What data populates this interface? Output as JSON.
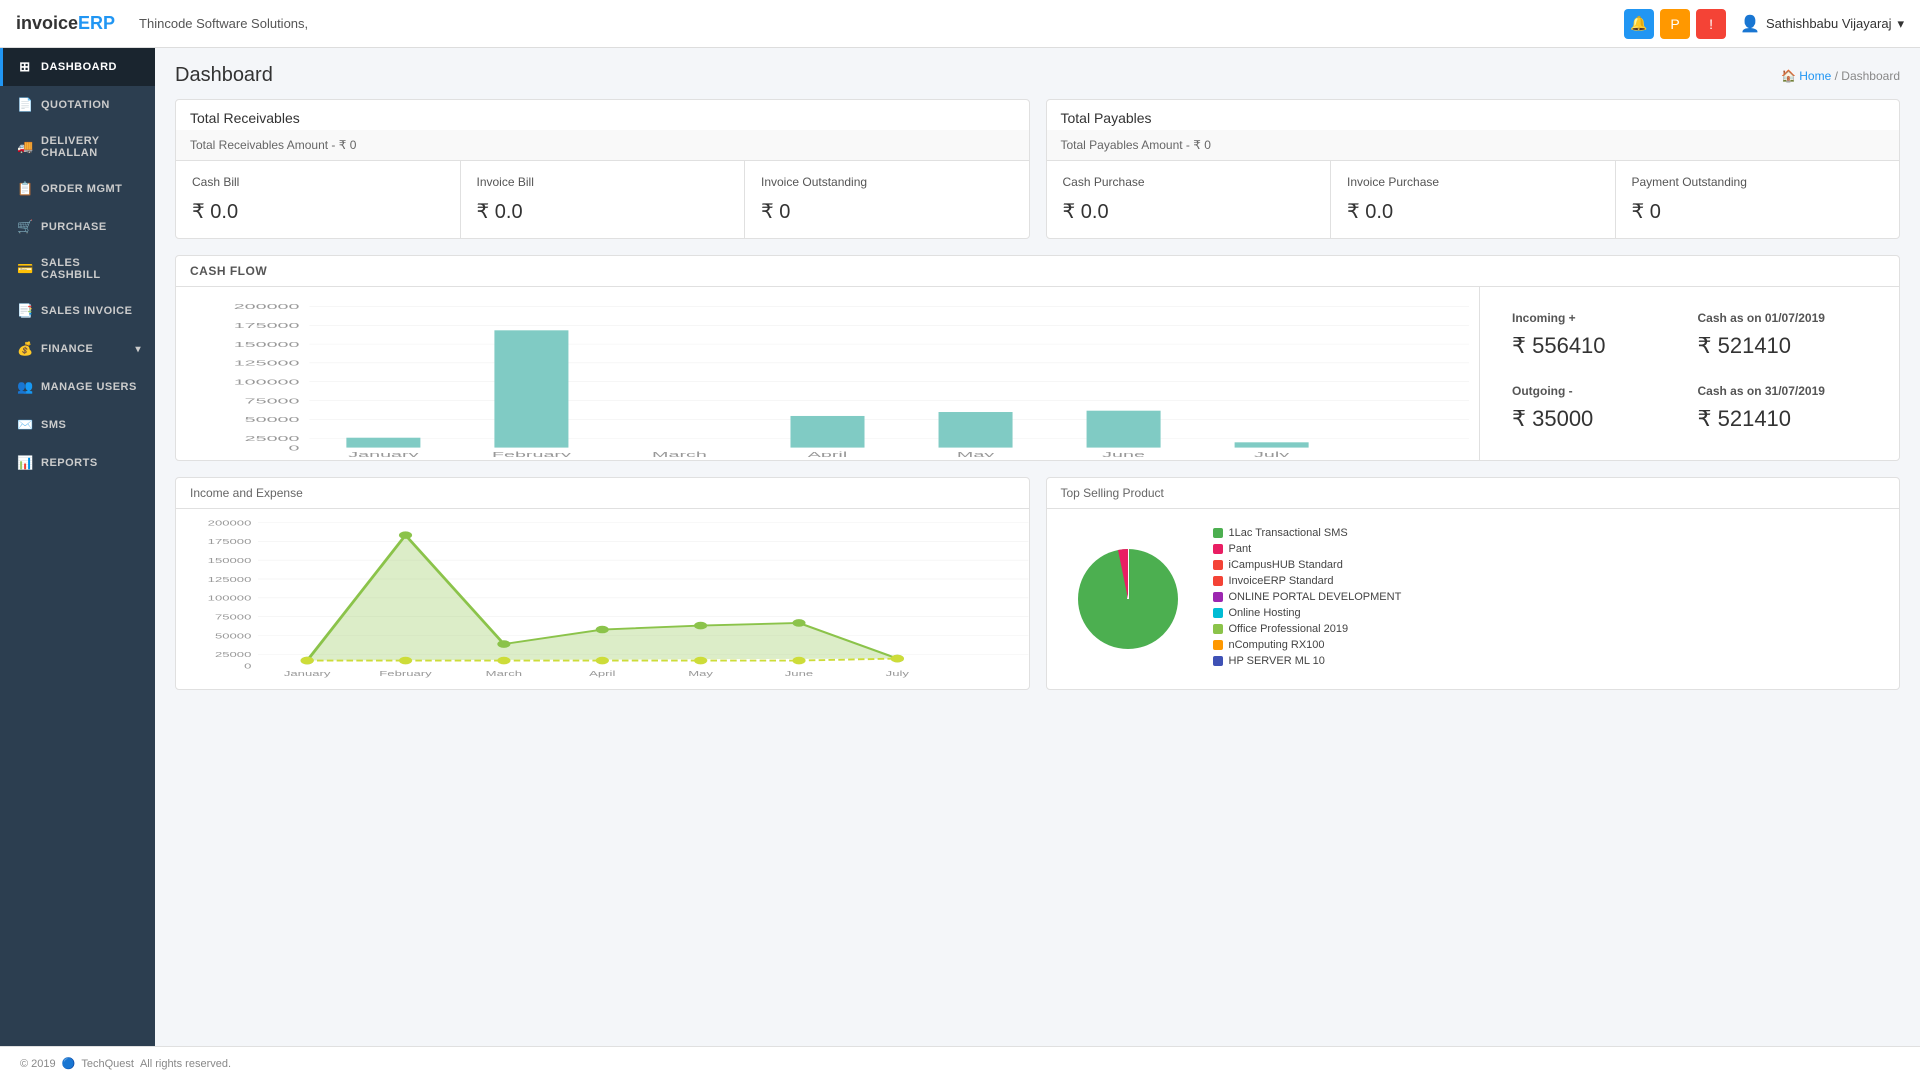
{
  "app": {
    "logo_text": "invoice",
    "logo_accent": "ERP",
    "company": "Thincode Software Solutions,",
    "user": "Sathishbabu Vijayaraj",
    "page_title": "Dashboard",
    "breadcrumb_home": "Home",
    "breadcrumb_current": "Dashboard"
  },
  "sidebar": {
    "items": [
      {
        "id": "dashboard",
        "label": "Dashboard",
        "icon": "⊞",
        "active": true
      },
      {
        "id": "quotation",
        "label": "Quotation",
        "icon": "📄",
        "active": false
      },
      {
        "id": "delivery",
        "label": "Delivery Challan",
        "icon": "🚚",
        "active": false
      },
      {
        "id": "order",
        "label": "Order MGMT",
        "icon": "📋",
        "active": false
      },
      {
        "id": "purchase",
        "label": "Purchase",
        "icon": "🛒",
        "active": false
      },
      {
        "id": "sales_cashbill",
        "label": "Sales Cashbill",
        "icon": "💳",
        "active": false
      },
      {
        "id": "sales_invoice",
        "label": "Sales Invoice",
        "icon": "📑",
        "active": false
      },
      {
        "id": "finance",
        "label": "Finance",
        "icon": "💰",
        "active": false,
        "has_arrow": true
      },
      {
        "id": "manage_users",
        "label": "Manage Users",
        "icon": "👥",
        "active": false
      },
      {
        "id": "sms",
        "label": "SMS",
        "icon": "✉️",
        "active": false
      },
      {
        "id": "reports",
        "label": "Reports",
        "icon": "📊",
        "active": false
      }
    ]
  },
  "receivables": {
    "section_title": "Total Receivables",
    "amount_label": "Total Receivables Amount - ₹ 0",
    "metrics": [
      {
        "label": "Cash Bill",
        "value": "₹ 0.0"
      },
      {
        "label": "Invoice Bill",
        "value": "₹ 0.0"
      },
      {
        "label": "Invoice Outstanding",
        "value": "₹ 0"
      }
    ]
  },
  "payables": {
    "section_title": "Total Payables",
    "amount_label": "Total Payables Amount - ₹ 0",
    "metrics": [
      {
        "label": "Cash Purchase",
        "value": "₹ 0.0"
      },
      {
        "label": "Invoice Purchase",
        "value": "₹ 0.0"
      },
      {
        "label": "Payment Outstanding",
        "value": "₹ 0"
      }
    ]
  },
  "cashflow": {
    "title": "CASH FLOW",
    "months": [
      "January",
      "February",
      "March",
      "April",
      "May",
      "June",
      "July"
    ],
    "bar_values": [
      15000,
      178000,
      0,
      48000,
      54000,
      56000,
      8000
    ],
    "y_labels": [
      "200000",
      "175000",
      "150000",
      "125000",
      "100000",
      "75000",
      "50000",
      "25000",
      "0"
    ],
    "incoming_label": "Incoming +",
    "incoming_value": "₹ 556410",
    "outgoing_label": "Outgoing -",
    "outgoing_value": "₹ 35000",
    "cash_as_on_start_label": "Cash as on 01/07/2019",
    "cash_as_on_start_value": "₹ 521410",
    "cash_as_on_end_label": "Cash as on 31/07/2019",
    "cash_as_on_end_value": "₹ 521410"
  },
  "income_expense": {
    "title": "Income and Expense",
    "months": [
      "January",
      "February",
      "March",
      "April",
      "May",
      "June",
      "July"
    ],
    "income_values": [
      5000,
      195000,
      30000,
      52000,
      58000,
      62000,
      8000
    ],
    "expense_values": [
      5000,
      5000,
      5000,
      5000,
      5000,
      5000,
      8000
    ],
    "y_labels": [
      "200000",
      "175000",
      "150000",
      "125000",
      "100000",
      "75000",
      "50000",
      "25000",
      "0"
    ]
  },
  "top_selling": {
    "title": "Top Selling Product",
    "items": [
      {
        "label": "1Lac Transactional SMS",
        "color": "#4CAF50"
      },
      {
        "label": "Pant",
        "color": "#E91E63"
      },
      {
        "label": "iCampusHUB Standard",
        "color": "#F44336"
      },
      {
        "label": "InvoiceERP Standard",
        "color": "#F44336"
      },
      {
        "label": "ONLINE PORTAL DEVELOPMENT",
        "color": "#9C27B0"
      },
      {
        "label": "Online Hosting",
        "color": "#00BCD4"
      },
      {
        "label": "Office Professional 2019",
        "color": "#8BC34A"
      },
      {
        "label": "nComputing RX100",
        "color": "#FF9800"
      },
      {
        "label": "HP SERVER ML 10",
        "color": "#3F51B5"
      }
    ],
    "pie_color": "#4CAF50"
  },
  "footer": {
    "copyright": "© 2019",
    "company": "TechQuest",
    "rights": "All rights reserved."
  }
}
